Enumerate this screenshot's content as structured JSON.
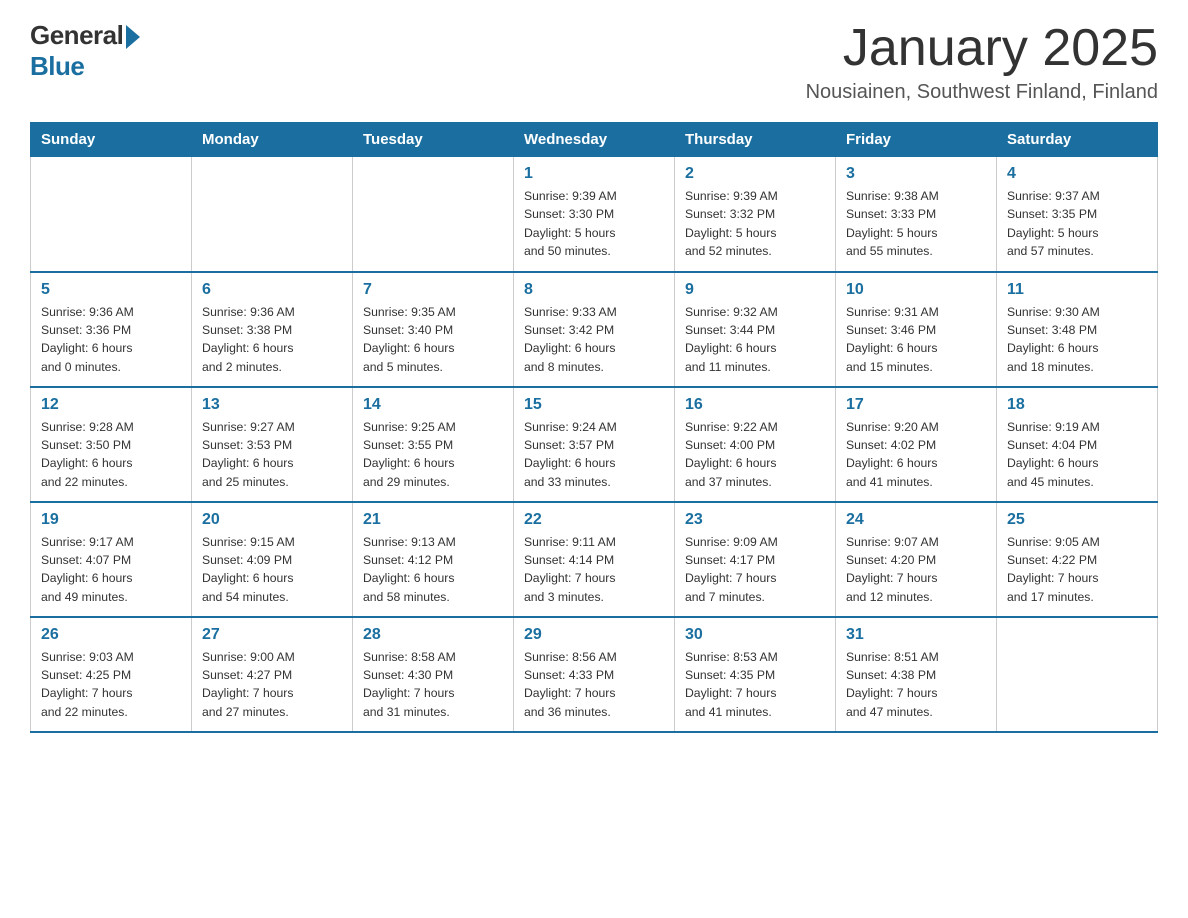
{
  "logo": {
    "general": "General",
    "blue": "Blue"
  },
  "title": "January 2025",
  "subtitle": "Nousiainen, Southwest Finland, Finland",
  "days_of_week": [
    "Sunday",
    "Monday",
    "Tuesday",
    "Wednesday",
    "Thursday",
    "Friday",
    "Saturday"
  ],
  "weeks": [
    [
      {
        "day": "",
        "info": ""
      },
      {
        "day": "",
        "info": ""
      },
      {
        "day": "",
        "info": ""
      },
      {
        "day": "1",
        "info": "Sunrise: 9:39 AM\nSunset: 3:30 PM\nDaylight: 5 hours\nand 50 minutes."
      },
      {
        "day": "2",
        "info": "Sunrise: 9:39 AM\nSunset: 3:32 PM\nDaylight: 5 hours\nand 52 minutes."
      },
      {
        "day": "3",
        "info": "Sunrise: 9:38 AM\nSunset: 3:33 PM\nDaylight: 5 hours\nand 55 minutes."
      },
      {
        "day": "4",
        "info": "Sunrise: 9:37 AM\nSunset: 3:35 PM\nDaylight: 5 hours\nand 57 minutes."
      }
    ],
    [
      {
        "day": "5",
        "info": "Sunrise: 9:36 AM\nSunset: 3:36 PM\nDaylight: 6 hours\nand 0 minutes."
      },
      {
        "day": "6",
        "info": "Sunrise: 9:36 AM\nSunset: 3:38 PM\nDaylight: 6 hours\nand 2 minutes."
      },
      {
        "day": "7",
        "info": "Sunrise: 9:35 AM\nSunset: 3:40 PM\nDaylight: 6 hours\nand 5 minutes."
      },
      {
        "day": "8",
        "info": "Sunrise: 9:33 AM\nSunset: 3:42 PM\nDaylight: 6 hours\nand 8 minutes."
      },
      {
        "day": "9",
        "info": "Sunrise: 9:32 AM\nSunset: 3:44 PM\nDaylight: 6 hours\nand 11 minutes."
      },
      {
        "day": "10",
        "info": "Sunrise: 9:31 AM\nSunset: 3:46 PM\nDaylight: 6 hours\nand 15 minutes."
      },
      {
        "day": "11",
        "info": "Sunrise: 9:30 AM\nSunset: 3:48 PM\nDaylight: 6 hours\nand 18 minutes."
      }
    ],
    [
      {
        "day": "12",
        "info": "Sunrise: 9:28 AM\nSunset: 3:50 PM\nDaylight: 6 hours\nand 22 minutes."
      },
      {
        "day": "13",
        "info": "Sunrise: 9:27 AM\nSunset: 3:53 PM\nDaylight: 6 hours\nand 25 minutes."
      },
      {
        "day": "14",
        "info": "Sunrise: 9:25 AM\nSunset: 3:55 PM\nDaylight: 6 hours\nand 29 minutes."
      },
      {
        "day": "15",
        "info": "Sunrise: 9:24 AM\nSunset: 3:57 PM\nDaylight: 6 hours\nand 33 minutes."
      },
      {
        "day": "16",
        "info": "Sunrise: 9:22 AM\nSunset: 4:00 PM\nDaylight: 6 hours\nand 37 minutes."
      },
      {
        "day": "17",
        "info": "Sunrise: 9:20 AM\nSunset: 4:02 PM\nDaylight: 6 hours\nand 41 minutes."
      },
      {
        "day": "18",
        "info": "Sunrise: 9:19 AM\nSunset: 4:04 PM\nDaylight: 6 hours\nand 45 minutes."
      }
    ],
    [
      {
        "day": "19",
        "info": "Sunrise: 9:17 AM\nSunset: 4:07 PM\nDaylight: 6 hours\nand 49 minutes."
      },
      {
        "day": "20",
        "info": "Sunrise: 9:15 AM\nSunset: 4:09 PM\nDaylight: 6 hours\nand 54 minutes."
      },
      {
        "day": "21",
        "info": "Sunrise: 9:13 AM\nSunset: 4:12 PM\nDaylight: 6 hours\nand 58 minutes."
      },
      {
        "day": "22",
        "info": "Sunrise: 9:11 AM\nSunset: 4:14 PM\nDaylight: 7 hours\nand 3 minutes."
      },
      {
        "day": "23",
        "info": "Sunrise: 9:09 AM\nSunset: 4:17 PM\nDaylight: 7 hours\nand 7 minutes."
      },
      {
        "day": "24",
        "info": "Sunrise: 9:07 AM\nSunset: 4:20 PM\nDaylight: 7 hours\nand 12 minutes."
      },
      {
        "day": "25",
        "info": "Sunrise: 9:05 AM\nSunset: 4:22 PM\nDaylight: 7 hours\nand 17 minutes."
      }
    ],
    [
      {
        "day": "26",
        "info": "Sunrise: 9:03 AM\nSunset: 4:25 PM\nDaylight: 7 hours\nand 22 minutes."
      },
      {
        "day": "27",
        "info": "Sunrise: 9:00 AM\nSunset: 4:27 PM\nDaylight: 7 hours\nand 27 minutes."
      },
      {
        "day": "28",
        "info": "Sunrise: 8:58 AM\nSunset: 4:30 PM\nDaylight: 7 hours\nand 31 minutes."
      },
      {
        "day": "29",
        "info": "Sunrise: 8:56 AM\nSunset: 4:33 PM\nDaylight: 7 hours\nand 36 minutes."
      },
      {
        "day": "30",
        "info": "Sunrise: 8:53 AM\nSunset: 4:35 PM\nDaylight: 7 hours\nand 41 minutes."
      },
      {
        "day": "31",
        "info": "Sunrise: 8:51 AM\nSunset: 4:38 PM\nDaylight: 7 hours\nand 47 minutes."
      },
      {
        "day": "",
        "info": ""
      }
    ]
  ]
}
